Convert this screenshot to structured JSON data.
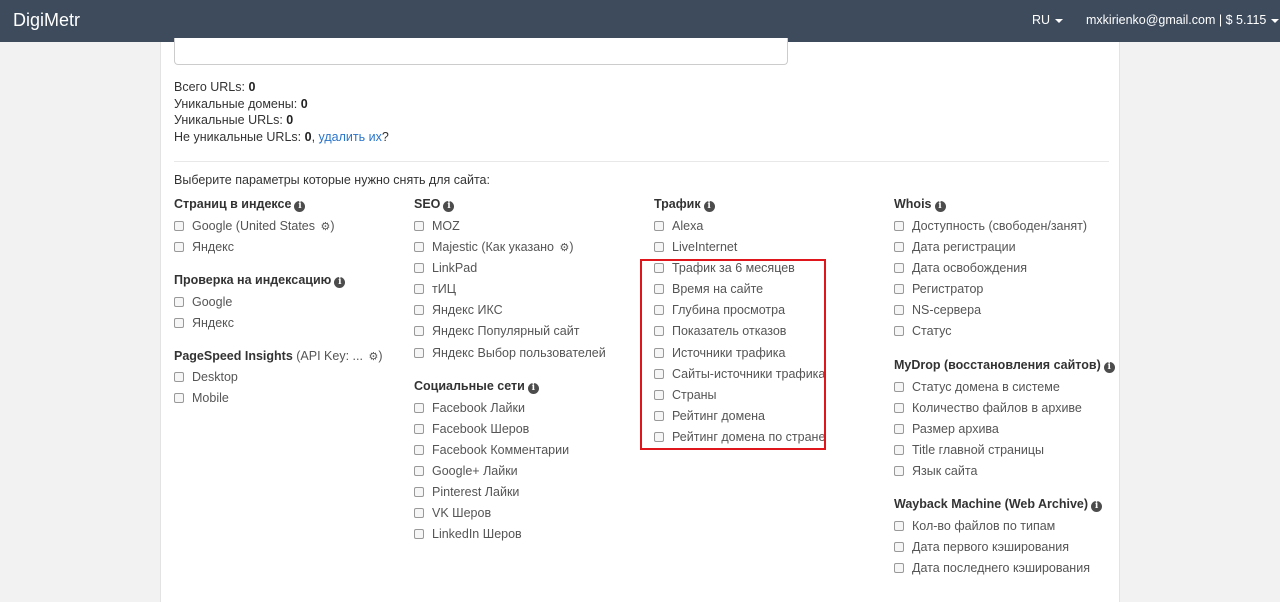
{
  "navbar": {
    "brand": "DigiMetr",
    "language": "RU",
    "account": "mxkirienko@gmail.com | $ 5.115"
  },
  "stats": {
    "total_label": "Всего URLs:",
    "total_value": "0",
    "unique_domains_label": "Уникальные домены:",
    "unique_domains_value": "0",
    "unique_urls_label": "Уникальные URLs:",
    "unique_urls_value": "0",
    "non_unique_label": "Не уникальные URLs:",
    "non_unique_value": "0",
    "delete_link": "удалить их",
    "delete_suffix": "?"
  },
  "intro": "Выберите параметры которые нужно снять для сайта:",
  "columns": {
    "index": {
      "title": "Страниц в индексе",
      "items": [
        "Google",
        "Яндекс"
      ],
      "google_note": "(United States"
    },
    "indexing": {
      "title": "Проверка на индексацию",
      "items": [
        "Google",
        "Яндекс"
      ]
    },
    "pagespeed": {
      "title": "PageSpeed Insights",
      "title_note": "(API Key: ...",
      "items": [
        "Desktop",
        "Mobile"
      ]
    },
    "seo": {
      "title": "SEO",
      "items": [
        "MOZ",
        "Majestic",
        "LinkPad",
        "тИЦ",
        "Яндекс ИКС",
        "Яндекс Популярный сайт",
        "Яндекс Выбор пользователей"
      ],
      "majestic_note": "(Как указано"
    },
    "social": {
      "title": "Социальные сети",
      "items": [
        "Facebook Лайки",
        "Facebook Шеров",
        "Facebook Комментарии",
        "Google+ Лайки",
        "Pinterest Лайки",
        "VK Шеров",
        "LinkedIn Шеров"
      ]
    },
    "traffic": {
      "title": "Трафик",
      "items": [
        "Alexa",
        "LiveInternet",
        "Трафик за 6 месяцев",
        "Время на сайте",
        "Глубина просмотра",
        "Показатель отказов",
        "Источники трафика",
        "Сайты-источники трафика",
        "Страны",
        "Рейтинг домена",
        "Рейтинг домена по стране"
      ]
    },
    "whois": {
      "title": "Whois",
      "items": [
        "Доступность (свободен/занят)",
        "Дата регистрации",
        "Дата освобождения",
        "Регистратор",
        "NS-сервера",
        "Статус"
      ]
    },
    "mydrop": {
      "title": "MyDrop (восстановления сайтов)",
      "items": [
        "Статус домена в системе",
        "Количество файлов в архиве",
        "Размер архива",
        "Title главной страницы",
        "Язык сайта"
      ]
    },
    "wayback": {
      "title": "Wayback Machine (Web Archive)",
      "items": [
        "Кол-во файлов по типам",
        "Дата первого кэширования",
        "Дата последнего кэширования"
      ]
    }
  },
  "colors": {
    "navbar_bg": "#3d4b5c",
    "link": "#2a74c9",
    "highlight_border": "#e0161d"
  }
}
